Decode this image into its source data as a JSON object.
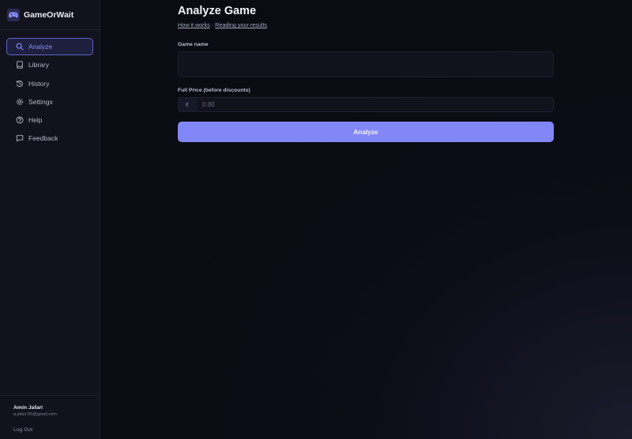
{
  "app": {
    "name": "GameOrWait",
    "logo_icon": "gamepad-icon",
    "accent_color": "#8287f8"
  },
  "sidebar": {
    "items": [
      {
        "label": "Analyze",
        "icon": "search-icon",
        "active": true
      },
      {
        "label": "Library",
        "icon": "book-icon",
        "active": false
      },
      {
        "label": "History",
        "icon": "history-icon",
        "active": false
      },
      {
        "label": "Settings",
        "icon": "gear-icon",
        "active": false
      },
      {
        "label": "Help",
        "icon": "help-circle-icon",
        "active": false
      },
      {
        "label": "Feedback",
        "icon": "message-icon",
        "active": false
      }
    ],
    "user": {
      "name": "Amin Jafari",
      "email": "a.jafari.00@gmail.com",
      "logout_label": "Log Out"
    }
  },
  "main": {
    "title": "Analyze Game",
    "links": {
      "how_it_works": "How it works",
      "separator": "·",
      "reading_results": "Reading your results"
    },
    "form": {
      "game_name_label": "Game name",
      "game_name_value": "",
      "game_name_placeholder": "",
      "price_label": "Full Price (before discounts)",
      "currency_symbol": "€",
      "price_value": "",
      "price_placeholder": "0.00",
      "submit_label": "Analyze"
    }
  }
}
